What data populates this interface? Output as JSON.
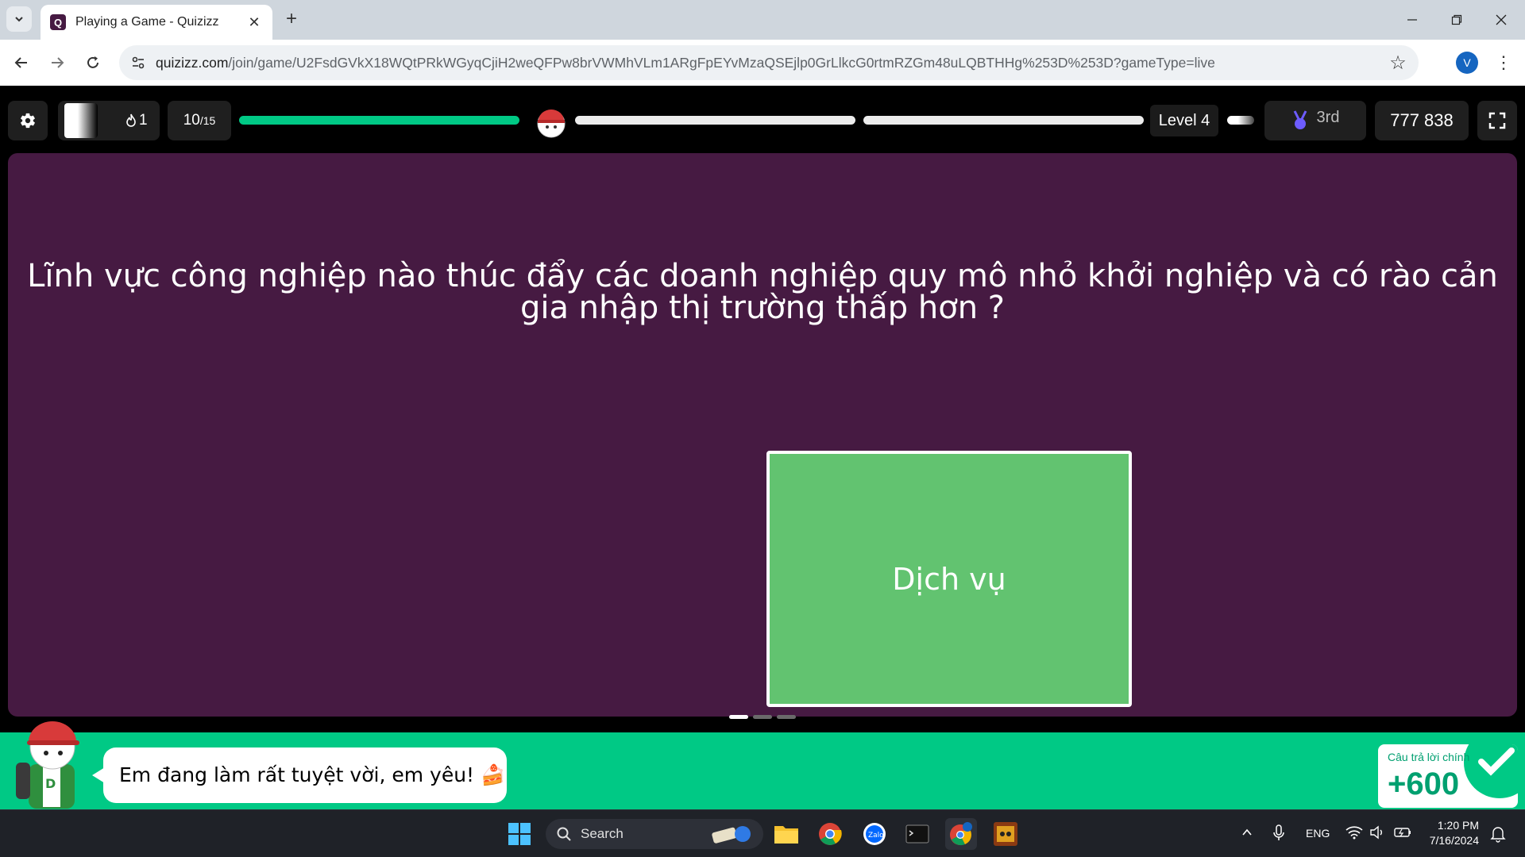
{
  "browser": {
    "tab_title": "Playing a Game - Quizizz",
    "favicon_letter": "Q",
    "url_domain": "quizizz.com",
    "url_path": "/join/game/U2FsdGVkX18WQtPRkWGyqCjiH2weQFPw8brVWMhVLm1ARgFpEYvMzaQSEjlp0GrLlkcG0rtmRZGm48uLQBTHHg%253D%253D?gameType=live",
    "profile_initial": "V"
  },
  "hud": {
    "streak_count": "1",
    "question_current": "10",
    "question_total": "/15",
    "level_label": "Level 4",
    "rank_label": "3rd",
    "score": "777 838",
    "progress_segments": [
      1.0,
      0.0,
      0.0
    ]
  },
  "question": {
    "text": "Lĩnh vực công nghiệp nào thúc đẩy các doanh nghiệp quy mô nhỏ khởi nghiệp và có rào cản gia nhập thị trường thấp hơn ?"
  },
  "answer": {
    "text": "Dịch vụ",
    "color": "#62c370"
  },
  "feedback": {
    "message": "Em đang làm rất tuyệt vời, em yêu! 🍰",
    "result_label": "Câu trả lời chính",
    "points": "+600"
  },
  "taskbar": {
    "search_label": "Search",
    "language": "ENG",
    "time": "1:20 PM",
    "date": "7/16/2024"
  },
  "colors": {
    "stage_bg": "#461a42",
    "accent_green": "#00c985",
    "progress_green": "#00c985"
  }
}
